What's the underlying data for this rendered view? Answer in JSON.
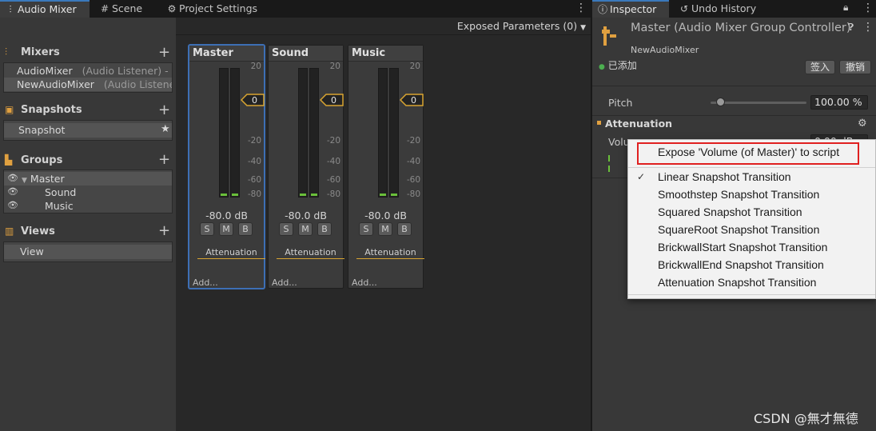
{
  "tabs_left": [
    {
      "label": "Audio Mixer",
      "icon": "audio-mixer-icon"
    },
    {
      "label": "Scene",
      "icon": "scene-hash-icon"
    },
    {
      "label": "Project Settings",
      "icon": "gear-icon"
    }
  ],
  "tabs_right": [
    {
      "label": "Inspector",
      "icon": "info-icon"
    },
    {
      "label": "Undo History",
      "icon": "history-icon"
    }
  ],
  "exposed_parameters": "Exposed Parameters (0)",
  "sidebar": {
    "mixers": {
      "title": "Mixers",
      "items": [
        {
          "name": "AudioMixer",
          "detail": "(Audio Listener) - I"
        },
        {
          "name": "NewAudioMixer",
          "detail": "(Audio Listene"
        }
      ]
    },
    "snapshots": {
      "title": "Snapshots",
      "items": [
        "Snapshot"
      ]
    },
    "groups": {
      "title": "Groups",
      "items": [
        "Master",
        "Sound",
        "Music"
      ]
    },
    "views": {
      "title": "Views",
      "items": [
        "View"
      ]
    }
  },
  "strips": [
    {
      "name": "Master",
      "db": "-80.0 dB",
      "marker_value": "0",
      "effect": "Attenuation",
      "add": "Add..."
    },
    {
      "name": "Sound",
      "db": "-80.0 dB",
      "marker_value": "0",
      "effect": "Attenuation",
      "add": "Add..."
    },
    {
      "name": "Music",
      "db": "-80.0 dB",
      "marker_value": "0",
      "effect": "Attenuation",
      "add": "Add..."
    }
  ],
  "meter_ticks": [
    "20",
    "-20",
    "-40",
    "-60",
    "-80"
  ],
  "strip_buttons": [
    "S",
    "M",
    "B"
  ],
  "inspector": {
    "title": "Master (Audio Mixer Group Controller)",
    "subtitle": "NewAudioMixer",
    "added": "已添加",
    "btn_checkin": "签入",
    "btn_revert": "撤销",
    "pitch_label": "Pitch",
    "pitch_value": "100.00 %",
    "pitch_fraction": 0.1,
    "attenuation_title": "Attenuation",
    "volume_label": "Volu",
    "volume_value_partial": "0.00 dB"
  },
  "context_menu": {
    "highlighted": "Expose 'Volume (of Master)' to script",
    "items": [
      {
        "label": "Linear Snapshot Transition",
        "checked": true
      },
      {
        "label": "Smoothstep Snapshot Transition",
        "checked": false
      },
      {
        "label": "Squared Snapshot Transition",
        "checked": false
      },
      {
        "label": "SquareRoot Snapshot Transition",
        "checked": false
      },
      {
        "label": "BrickwallStart Snapshot Transition",
        "checked": false
      },
      {
        "label": "BrickwallEnd Snapshot Transition",
        "checked": false
      },
      {
        "label": "Attenuation Snapshot Transition",
        "checked": false
      }
    ]
  },
  "watermark": "CSDN @無才無德",
  "colors": {
    "accent_blue": "#3a79bb",
    "accent_orange": "#d9a531",
    "highlight_red": "#e02020",
    "meter_green": "#6abf3a"
  }
}
